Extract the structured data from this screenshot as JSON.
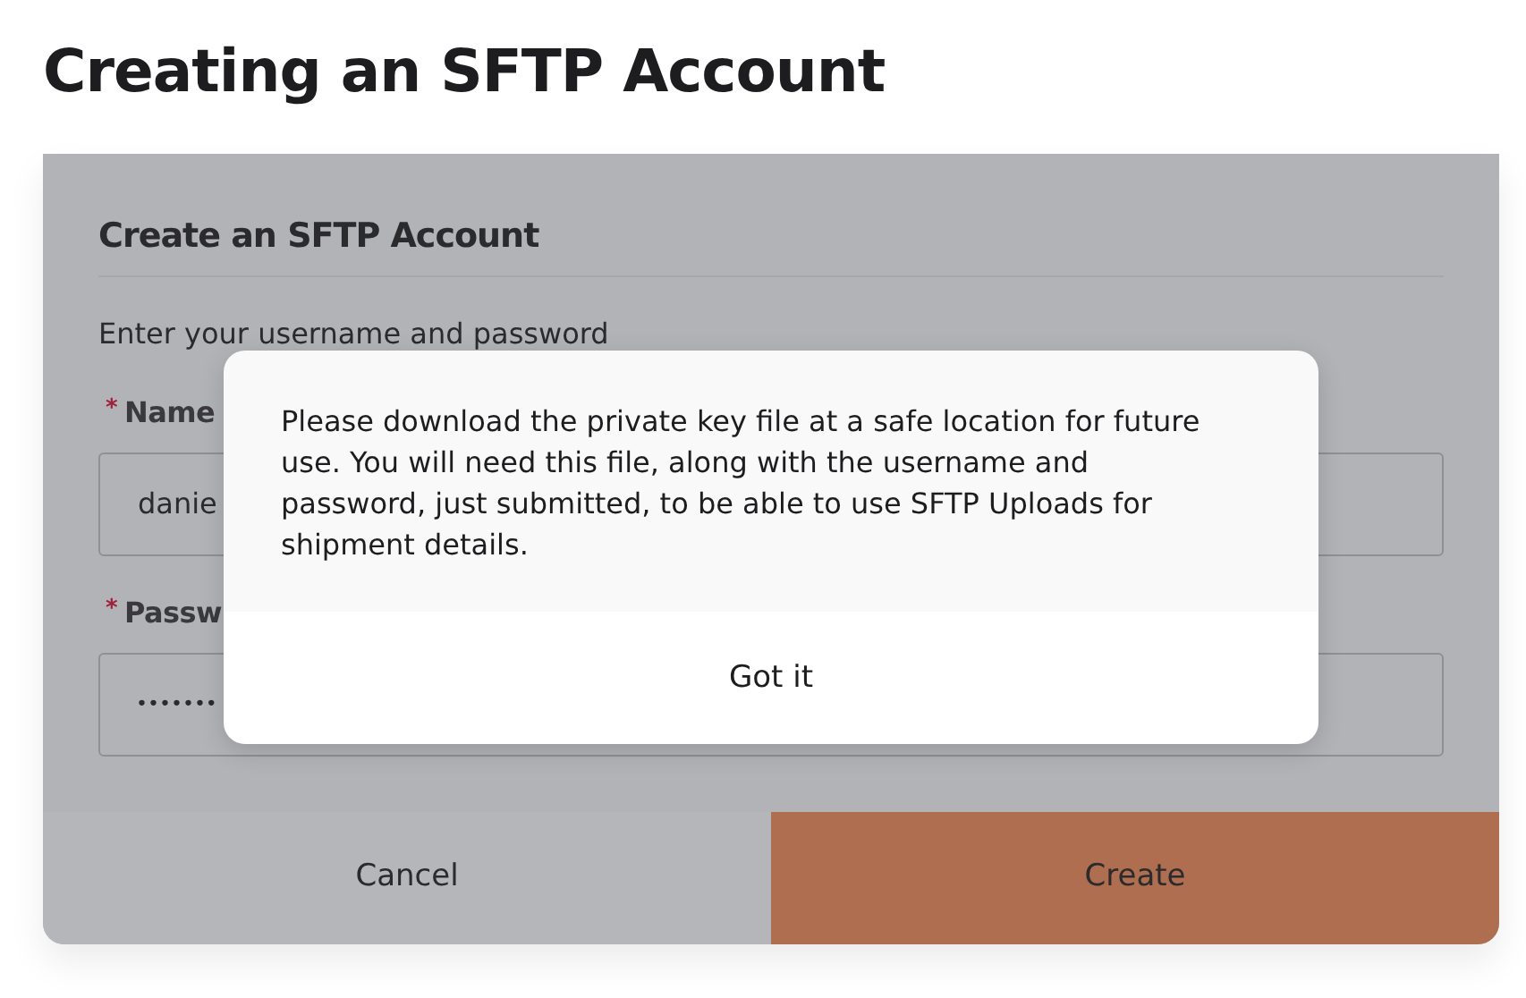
{
  "page_title": "Creating an SFTP Account",
  "form": {
    "heading": "Create an SFTP Account",
    "instructions": "Enter your username and password",
    "fields": [
      {
        "kind": "text",
        "required_mark": "*",
        "label": "Name",
        "value": "danie"
      },
      {
        "kind": "password",
        "required_mark": "*",
        "label": "Passw",
        "value": "•••••••"
      }
    ],
    "buttons": [
      {
        "label": "Cancel",
        "kind": "secondary"
      },
      {
        "label": "Create",
        "kind": "primary"
      }
    ]
  },
  "dialog": {
    "message": "Please download the private key file at a safe location for future use. You will need this file, along with the username and password, just submitted, to be able to use SFTP Uploads for shipment details.",
    "button": "Got it"
  }
}
